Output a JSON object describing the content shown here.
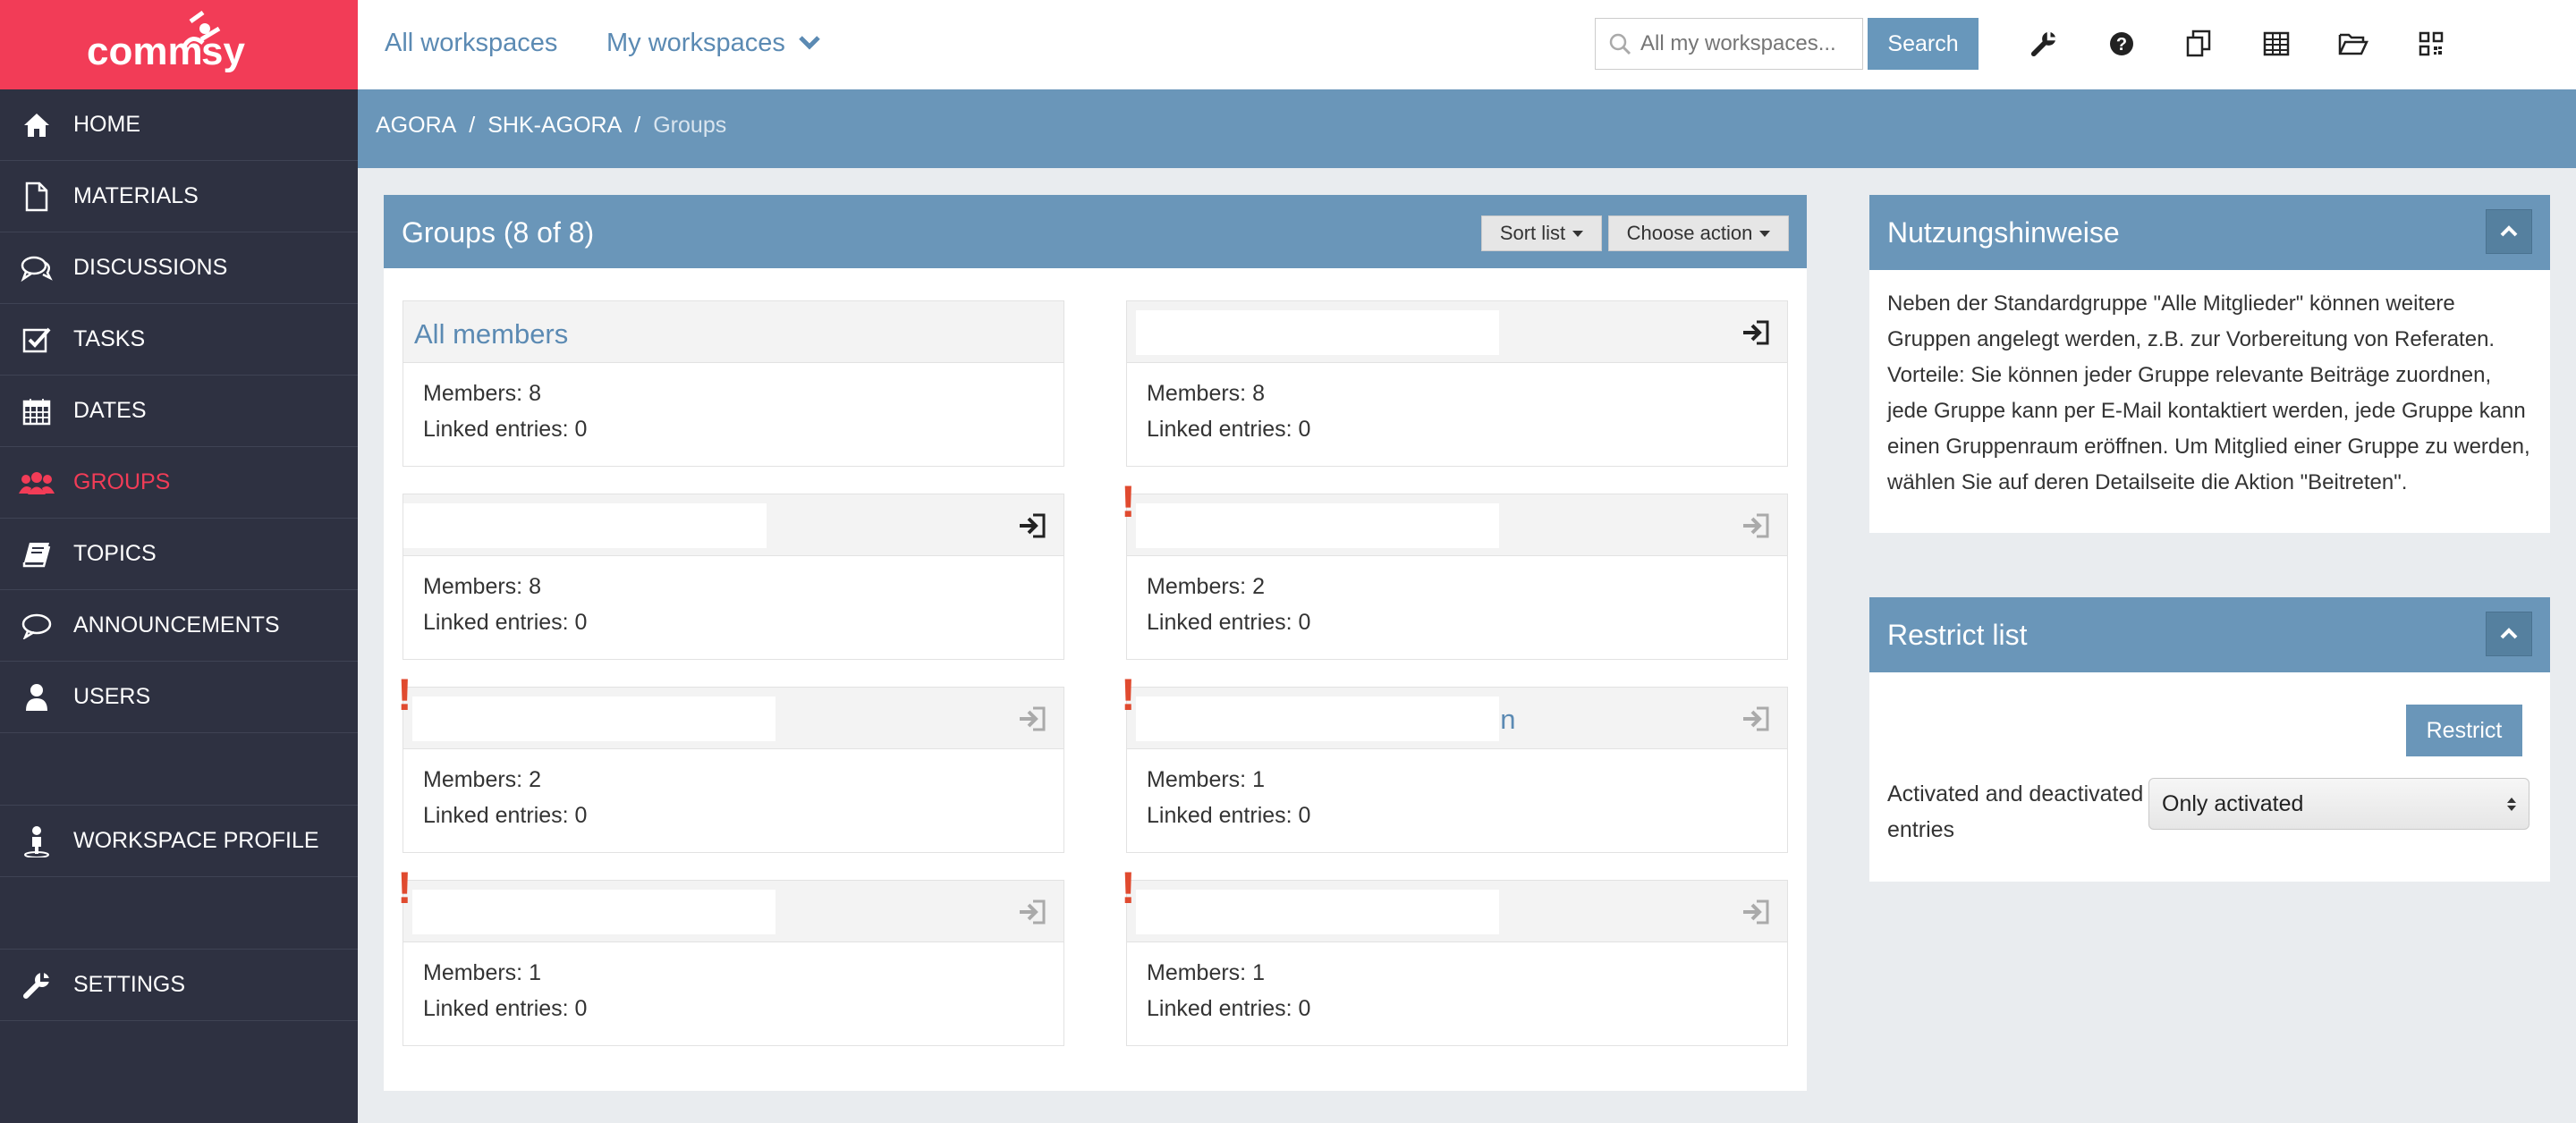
{
  "logo": {
    "text": "commsy"
  },
  "sidebar": {
    "items": [
      {
        "label": "HOME",
        "icon": "home-icon"
      },
      {
        "label": "MATERIALS",
        "icon": "file-icon"
      },
      {
        "label": "DISCUSSIONS",
        "icon": "comments-icon"
      },
      {
        "label": "TASKS",
        "icon": "check-square-icon"
      },
      {
        "label": "DATES",
        "icon": "calendar-icon"
      },
      {
        "label": "GROUPS",
        "icon": "users-icon",
        "active": true
      },
      {
        "label": "TOPICS",
        "icon": "book-icon"
      },
      {
        "label": "ANNOUNCEMENTS",
        "icon": "comment-icon"
      },
      {
        "label": "USERS",
        "icon": "user-icon"
      },
      {
        "label": "WORKSPACE PROFILE",
        "icon": "profile-icon"
      },
      {
        "label": "SETTINGS",
        "icon": "wrench-icon"
      }
    ]
  },
  "topnav": {
    "all_workspaces": "All workspaces",
    "my_workspaces": "My workspaces",
    "search_placeholder": "All my workspaces...",
    "search_button": "Search"
  },
  "breadcrumb": {
    "level1": "AGORA",
    "level2": "SHK-AGORA",
    "current": "Groups"
  },
  "groups_panel": {
    "title": "Groups (8 of 8)",
    "sort_button": "Sort list",
    "action_button": "Choose action",
    "cards": [
      {
        "title": "All members",
        "members": "Members: 8",
        "linked": "Linked entries: 0"
      },
      {
        "title": "",
        "members": "Members: 8",
        "linked": "Linked entries: 0"
      },
      {
        "title": "",
        "members": "Members: 8",
        "linked": "Linked entries: 0"
      },
      {
        "title": "",
        "members": "Members: 2",
        "linked": "Linked entries: 0"
      },
      {
        "title": "",
        "members": "Members: 2",
        "linked": "Linked entries: 0"
      },
      {
        "title": "",
        "peek": "en",
        "members": "Members: 1",
        "linked": "Linked entries: 0"
      },
      {
        "title": "",
        "members": "Members: 1",
        "linked": "Linked entries: 0"
      },
      {
        "title": "",
        "members": "Members: 1",
        "linked": "Linked entries: 0"
      }
    ]
  },
  "hints_panel": {
    "title": "Nutzungshinweise",
    "text": "Neben der Standardgruppe \"Alle Mitglieder\" können weitere Gruppen angelegt werden, z.B. zur Vorbereitung von Referaten. Vorteile: Sie können jeder Gruppe relevante Beiträge zuordnen, jede Gruppe kann per E-Mail kontaktiert werden, jede Gruppe kann einen Gruppenraum eröffnen. Um Mitglied einer Gruppe zu werden, wählen Sie auf deren Detailseite die Aktion \"Beitreten\"."
  },
  "restrict_panel": {
    "title": "Restrict list",
    "button": "Restrict",
    "label": "Activated and deactivated entries",
    "select_value": "Only activated"
  },
  "colors": {
    "brand": "#f23c57",
    "sidebar_bg": "#2e3141",
    "header_blue": "#6a96b9",
    "link_blue": "#5b8ab3",
    "alert_red": "#e04a2f"
  }
}
